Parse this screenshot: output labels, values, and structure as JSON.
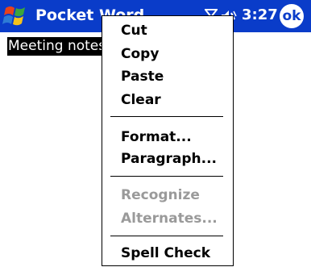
{
  "title_bar": {
    "app_title": "Pocket Word",
    "time": "3:27",
    "ok_label": "ok",
    "bg_color": "#0a3cc9",
    "start_icon": "windows-flag-icon",
    "connectivity_icon": "antenna-icon",
    "volume_icon": "speaker-icon"
  },
  "document": {
    "selected_text": "Meeting notes"
  },
  "context_menu": {
    "items": [
      {
        "label": "Cut",
        "enabled": true
      },
      {
        "label": "Copy",
        "enabled": true
      },
      {
        "label": "Paste",
        "enabled": true
      },
      {
        "label": "Clear",
        "enabled": true
      },
      {
        "label": "Format...",
        "enabled": true
      },
      {
        "label": "Paragraph...",
        "enabled": true
      },
      {
        "label": "Recognize",
        "enabled": false
      },
      {
        "label": "Alternates...",
        "enabled": false
      },
      {
        "label": "Spell Check",
        "enabled": true
      }
    ],
    "disabled_color": "#9a9a9a"
  }
}
